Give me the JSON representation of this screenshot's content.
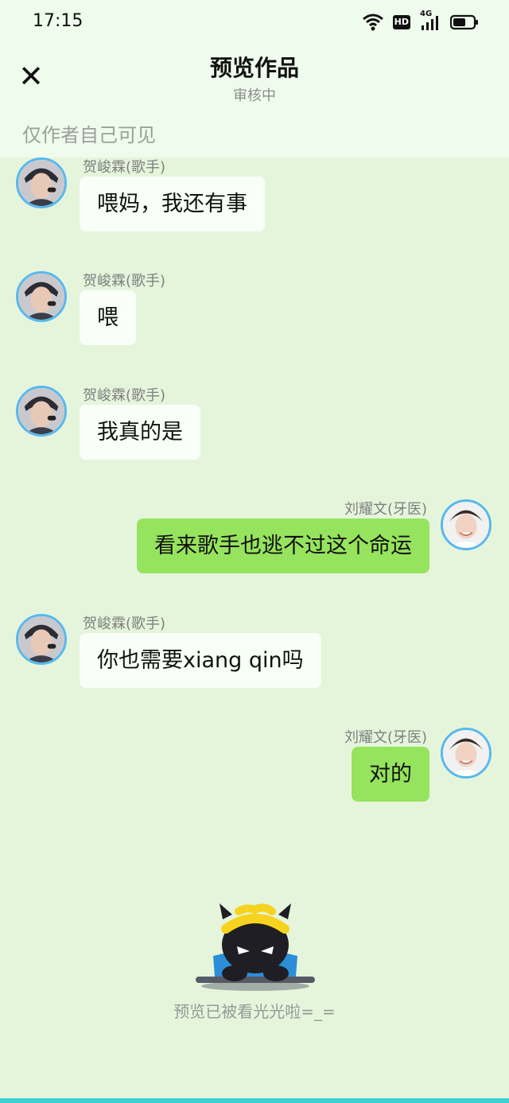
{
  "status": {
    "time": "17:15",
    "hd_badge": "HD",
    "network": "4G"
  },
  "header": {
    "title": "预览作品",
    "subtitle": "审核中",
    "visibility_note": "仅作者自己可见"
  },
  "messages": [
    {
      "side": "left",
      "name": "贺峻霖(歌手)",
      "text": "喂妈，我还有事"
    },
    {
      "side": "left",
      "name": "贺峻霖(歌手)",
      "text": "喂"
    },
    {
      "side": "left",
      "name": "贺峻霖(歌手)",
      "text": "我真的是"
    },
    {
      "side": "right",
      "name": "刘耀文(牙医)",
      "text": "看来歌手也逃不过这个命运"
    },
    {
      "side": "left",
      "name": "贺峻霖(歌手)",
      "text": "你也需要xiang qin吗"
    },
    {
      "side": "right",
      "name": "刘耀文(牙医)",
      "text": "对的"
    }
  ],
  "footer": {
    "text": "预览已被看光光啦=_="
  },
  "colors": {
    "background": "#e5f5dc",
    "header_bg": "#effbec",
    "left_bubble": "#f7fff6",
    "right_bubble": "#96e35d",
    "avatar_border": "#58b8ee",
    "bottom_bar": "#3fd0d6"
  }
}
